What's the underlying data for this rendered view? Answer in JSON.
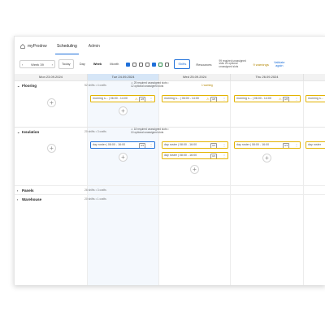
{
  "app": {
    "brand": "myProdnw"
  },
  "nav": {
    "items": [
      {
        "label": "Scheduling",
        "active": true
      },
      {
        "label": "Admin",
        "active": false
      }
    ]
  },
  "toolbar": {
    "week_label": "Week 39",
    "today": "Today",
    "views": [
      "Day",
      "Week",
      "Month"
    ],
    "selected_view": "Week",
    "shifts": "Shifts",
    "resources": "Resources",
    "unassigned_info": "99 required unassigned slots 26 optional unassigned slots",
    "warnings": "9 warnings",
    "validate": "Validate again"
  },
  "days": [
    {
      "label": "Mon 23.09.2024",
      "today": false
    },
    {
      "label": "Tue 24.09.2024",
      "today": true
    },
    {
      "label": "Wed 25.09.2024",
      "today": false
    },
    {
      "label": "Thu 26.09.2024",
      "today": false
    }
  ],
  "groups": [
    {
      "name": "Flooring",
      "meta": "52 shifts • 4 crafts",
      "alert": "25 required unassigned slots • 12 optional unassigned slots",
      "badge": "1 warning",
      "shifts": [
        {
          "label": "morning s... | 06:00 - 14:00",
          "count": "0/8",
          "col": 1
        },
        {
          "label": "morning s... | 06:00 - 14:00",
          "count": "0/8",
          "col": 2
        },
        {
          "label": "morning s... | 06:00 - 14:00",
          "count": "0/8",
          "col": 3
        },
        {
          "label": "morning s...",
          "count": "",
          "col": 4
        }
      ]
    },
    {
      "name": "Insulation",
      "meta": "20 shifts • 3 crafts",
      "alert": "18 required unassigned slots • 10 optional unassigned slots",
      "badge": "",
      "shifts": [
        {
          "label": "day roster | 08:00 - 16:00",
          "count": "0/4",
          "col": 1,
          "row": 0,
          "blue": true
        },
        {
          "label": "day roster | 08:00 - 16:00",
          "count": "0/4",
          "col": 2,
          "row": 0
        },
        {
          "label": "day roster | 08:00 - 16:00",
          "count": "0/4",
          "col": 2,
          "row": 1
        },
        {
          "label": "day roster | 08:00 - 16:00",
          "count": "0/4",
          "col": 3,
          "row": 0
        },
        {
          "label": "day roster",
          "count": "",
          "col": 4,
          "row": 0
        }
      ]
    }
  ],
  "collapsed_groups": [
    {
      "name": "Panels",
      "meta": "26 shifts • 3 crafts"
    },
    {
      "name": "Warehouse",
      "meta": "20 shifts • 1 crafts"
    }
  ]
}
